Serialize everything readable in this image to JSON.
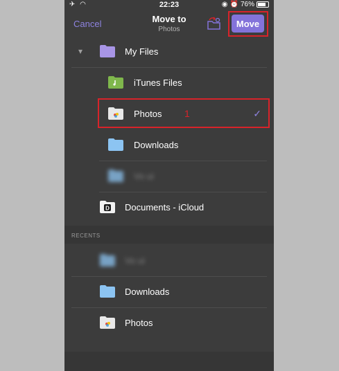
{
  "status": {
    "time": "22:23",
    "battery": "76%"
  },
  "nav": {
    "cancel": "Cancel",
    "title": "Move to",
    "subtitle": "Photos",
    "move": "Move"
  },
  "annotation": "1",
  "tree": {
    "my_files": "My Files",
    "itunes": "iTunes Files",
    "photos": "Photos",
    "downloads": "Downloads",
    "blurred": "Vo ui",
    "documents": "Documents - iCloud"
  },
  "recents": {
    "header": "RECENTS",
    "items": [
      {
        "label": "Vo ui"
      },
      {
        "label": "Downloads"
      },
      {
        "label": "Photos"
      }
    ]
  },
  "colors": {
    "accent": "#8373da",
    "highlight": "#d8232a",
    "folder_purple": "#a895e6",
    "folder_blue": "#8cc4f2",
    "folder_green": "#7fb74c"
  }
}
